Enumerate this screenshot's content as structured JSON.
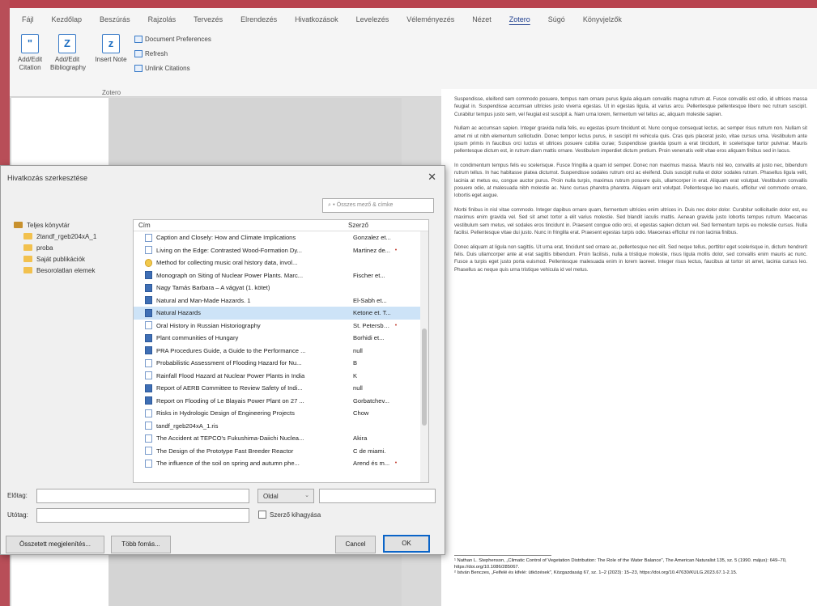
{
  "ribbon": {
    "tabs": [
      "Fájl",
      "Kezdőlap",
      "Beszúrás",
      "Rajzolás",
      "Tervezés",
      "Elrendezés",
      "Hivatkozások",
      "Levelezés",
      "Véleményezés",
      "Nézet",
      "Zotero",
      "Súgó",
      "Könyvjelzők"
    ],
    "active_tab": "Zotero",
    "buttons": {
      "add_edit_citation": "Add/Edit Citation",
      "add_edit_bibliography": "Add/Edit Bibliography",
      "insert_note": "Insert Note",
      "document_preferences": "Document Preferences",
      "refresh": "Refresh",
      "unlink_citations": "Unlink Citations"
    },
    "group_name": "Zotero"
  },
  "document": {
    "paragraphs": [
      "Suspendisse, eleifend sem commodo posuere, tempus nam ornare purus ligula aliquam convallis magna rutrum at. Fusce convallis est odio, id ultrices massa feugiat in. Suspendisse accumsan ultricies justo viverra egestas. Ut in egestas ligula, at varius arcu. Pellentesque pellentesque libero nec rutrum suscipit. Curabitur tempus justo sem, vel feugiat est suscipit a. Nam urna lorem, fermentum vel tellus ac, aliquam molestie sapien.",
      "Nullam ac accumsan sapien. Integer gravida nulla felis, eu egestas ipsum tincidunt et. Nunc congue consequat lectus, ac semper risus rutrum non. Nullam sit amet mi ut nibh elementum sollicitudin. Donec tempor lectus purus, in suscipit mi vehicula quis. Cras quis placerat justo, vitae cursus urna. Vestibulum ante ipsum primis in faucibus orci luctus et ultrices posuere cubilia curae; Suspendisse gravida ipsum a erat tincidunt, in scelerisque tortor pulvinar. Mauris pellentesque dictum est, in rutrum diam mattis ornare. Vestibulum imperdiet dictum pretium. Proin venenatis velit vitae eros aliquam finibus sed in lacus.",
      "In condimentum tempus felis eu scelerisque. Fusce fringilla a quam id semper. Donec non maximus massa. Mauris nisl leo, convallis at justo nec, bibendum rutrum tellus. In hac habitasse platea dictumst. Suspendisse sodales rutrum orci ac eleifend. Duis suscipit nulla et dolor sodales rutrum. Phasellus ligula velit, lacinia at metus eu, congue auctor purus. Proin nulla turpis, maximus rutrum posuere quis, ullamcorper in erat. Aliquam erat volutpat. Vestibulum convallis posuere odio, at malesuada nibh molestie ac. Nunc cursus pharetra pharetra. Aliquam erat volutpat. Pellentesque leo mauris, efficitur vel commodo ornare, lobortis eget augue.",
      "Morbi finibus in nisl vitae commodo. Integer dapibus ornare quam, fermentum ultricies enim ultrices in. Duis nec dolor dolor. Curabitur sollicitudin dolor est, eu maximus enim gravida vel. Sed sit amet tortor a elit varius molestie. Sed blandit iaculis mattis. Aenean gravida justo lobortis tempus rutrum. Maecenas vestibulum sem metus, vel sodales eros tincidunt in. Praesent congue odio orci, et egestas sapien dictum vel. Sed fermentum turpis eu molestie cursus. Nulla facilisi. Pellentesque vitae dui justo. Nunc in fringilla erat. Praesent egestas turpis odio. Maecenas efficitur mi non lacinia finibus.",
      "Donec aliquam at ligula non sagittis. Ut urna erat, tincidunt sed ornare ac, pellentesque nec elit. Sed neque tellus, porttitor eget scelerisque in, dictum hendrerit felis. Duis ullamcorper ante at erat sagittis bibendum. Proin facilisis, nulla a tristique molestie, risus ligula mollis dolor, sed convallis enim mauris ac nunc. Fusce a turpis eget justo porta euismod. Pellentesque malesuada enim in lorem laoreet. Integer risus lectus, faucibus at tortor sit amet, lacinia cursus leo. Phasellus ac neque quis urna tristique vehicula id vel metus."
    ],
    "footnotes": [
      "¹ Nathan L. Stephenson, „Climatic Control of Vegetation Distribution: The Role of the Water Balance\", The American Naturalist 135, sz. 5 (1990. május): 649–70, https://doi.org/10.1086/285067.",
      "² István Benczes, „Felfelé és kifelé: ütközések\", Közgazdaság 67, sz. 1–2 (2023): 15–23, https://doi.org/10.47630/KULG.2023.67.1-2.15."
    ]
  },
  "dialog": {
    "title": "Hivatkozás szerkesztése",
    "search_placeholder": "Összes mező & címke",
    "libraries": [
      {
        "label": "Teljes könyvtár",
        "type": "library"
      },
      {
        "label": "2tandf_rgeb204xA_1",
        "type": "folder"
      },
      {
        "label": "proba",
        "type": "folder"
      },
      {
        "label": "Saját publikációk",
        "type": "folder"
      },
      {
        "label": "Besorolatlan elemek",
        "type": "folder"
      }
    ],
    "columns": {
      "title": "Cím",
      "creator": "Szerző"
    },
    "items": [
      {
        "title": "Caption and Closely: How and Climate Implications",
        "creator": "Gonzalez et...",
        "icon": "doc",
        "mark": ""
      },
      {
        "title": "Living on the Edge: Contrasted Wood-Formation Dy...",
        "creator": "Martinez de...",
        "icon": "doc",
        "mark": "•"
      },
      {
        "title": "Method for collecting music oral history data, invol...",
        "creator": "",
        "icon": "bulb",
        "mark": ""
      },
      {
        "title": "Monograph on Siting of Nuclear Power Plants. Marc...",
        "creator": "Fischer et...",
        "icon": "book",
        "mark": ""
      },
      {
        "title": "Nagy Tamás Barbara – A vágyat (1. kötet)",
        "creator": "",
        "icon": "book",
        "mark": ""
      },
      {
        "title": "Natural and Man-Made Hazards. 1",
        "creator": "El-Sabh et...",
        "icon": "book",
        "mark": ""
      },
      {
        "title": "Natural Hazards",
        "creator": "Ketone et. T...",
        "icon": "book",
        "mark": "",
        "selected": true
      },
      {
        "title": "Oral History in Russian Historiography",
        "creator": "St. Petersbu...",
        "icon": "doc",
        "mark": "•"
      },
      {
        "title": "Plant communities of Hungary",
        "creator": "Borhidi et...",
        "icon": "book",
        "mark": ""
      },
      {
        "title": "PRA Procedures Guide, a Guide to the Performance ...",
        "creator": "null",
        "icon": "book",
        "mark": ""
      },
      {
        "title": "Probabilistic Assessment of Flooding Hazard for Nu...",
        "creator": "B",
        "icon": "doc",
        "mark": ""
      },
      {
        "title": "Rainfall Flood Hazard at Nuclear Power Plants in India",
        "creator": "K",
        "icon": "doc",
        "mark": ""
      },
      {
        "title": "Report of AERB Committee to Review Safety of Indi...",
        "creator": "null",
        "icon": "book",
        "mark": ""
      },
      {
        "title": "Report on Flooding of Le Blayais Power Plant on 27 ...",
        "creator": "Gorbatchev...",
        "icon": "book",
        "mark": ""
      },
      {
        "title": "Risks in Hydrologic Design of Engineering Projects",
        "creator": "Chow",
        "icon": "doc",
        "mark": ""
      },
      {
        "title": "tandf_rgeb204xA_1.ris",
        "creator": "",
        "icon": "doc",
        "mark": ""
      },
      {
        "title": "The Accident at TEPCO's Fukushima-Daiichi Nuclea...",
        "creator": "Akira",
        "icon": "doc",
        "mark": ""
      },
      {
        "title": "The Design of the Prototype Fast Breeder Reactor",
        "creator": "C de miami.",
        "icon": "doc",
        "mark": ""
      },
      {
        "title": "The influence of the soil on spring and autumn phe...",
        "creator": "Arend és m...",
        "icon": "doc",
        "mark": "•"
      }
    ],
    "prefix_label": "Előtag:",
    "suffix_label": "Utótag:",
    "prefix_value": "",
    "suffix_value": "",
    "locator_select": "Oldal",
    "locator_value": "",
    "omit_author_label": "Szerző kihagyása",
    "classic_view_button": "Összetett megjelenítés...",
    "multiple_sources_button": "Több forrás...",
    "cancel_button": "Cancel",
    "ok_button": "OK"
  }
}
